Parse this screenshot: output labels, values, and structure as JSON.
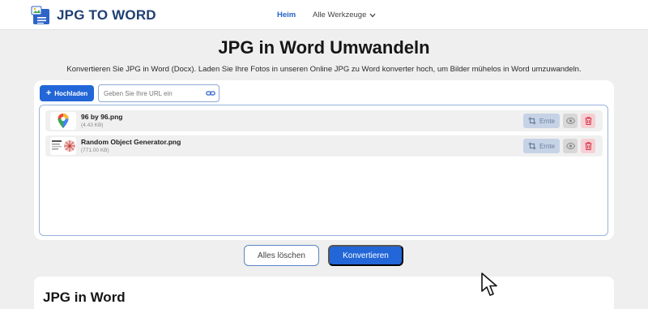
{
  "header": {
    "brand": "JPG TO WORD",
    "nav_home": "Heim",
    "nav_tools": "Alle Werkzeuge"
  },
  "main": {
    "title": "JPG in Word Umwandeln",
    "subtitle": "Konvertieren Sie JPG in Word (Docx). Laden Sie Ihre Fotos in unseren Online JPG zu Word konverter hoch, um Bilder mühelos in Word umzuwandeln."
  },
  "uploader": {
    "upload_label": "Hochladen",
    "url_placeholder": "Geben Sie Ihre URL ein",
    "files": [
      {
        "name": "96 by 96.png",
        "size": "(4.43 KB)",
        "crop_label": "Ernte"
      },
      {
        "name": "Random Object Generator.png",
        "size": "(771.00 KB)",
        "crop_label": "Ernte"
      }
    ]
  },
  "actions": {
    "clear_label": "Alles löschen",
    "convert_label": "Konvertieren"
  },
  "lower": {
    "title": "JPG in Word"
  },
  "colors": {
    "accent": "#2266d8",
    "brand_text": "#1f3f73",
    "crop_bg": "#c6d3e6",
    "delete_bg": "#f6d0d4",
    "delete_icon": "#d8334a"
  },
  "icons": [
    "logo-icon",
    "chevron-down-icon",
    "plus-icon",
    "link-icon",
    "crop-icon",
    "eye-icon",
    "trash-icon",
    "cursor-icon"
  ]
}
